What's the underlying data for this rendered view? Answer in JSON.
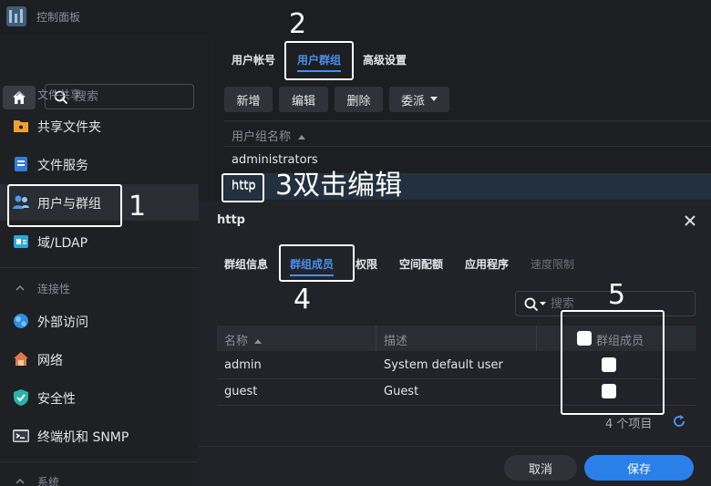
{
  "app": {
    "title": "控制面板"
  },
  "sidebar": {
    "search_placeholder": "搜索",
    "sections": [
      {
        "label": "文件共享",
        "items": [
          {
            "label": "共享文件夹",
            "icon": "folder-icon"
          },
          {
            "label": "文件服务",
            "icon": "file-services-icon"
          },
          {
            "label": "用户与群组",
            "icon": "users-icon",
            "active": true
          },
          {
            "label": "域/LDAP",
            "icon": "domain-icon"
          }
        ]
      },
      {
        "label": "连接性",
        "items": [
          {
            "label": "外部访问",
            "icon": "globe-icon"
          },
          {
            "label": "网络",
            "icon": "network-icon"
          },
          {
            "label": "安全性",
            "icon": "shield-icon"
          },
          {
            "label": "终端机和 SNMP",
            "icon": "terminal-icon"
          }
        ]
      },
      {
        "label": "系统",
        "items": []
      }
    ]
  },
  "main": {
    "tabs": [
      {
        "label": "用户帐号"
      },
      {
        "label": "用户群组",
        "active": true
      },
      {
        "label": "高级设置"
      }
    ],
    "toolbar": {
      "create": "新增",
      "edit": "编辑",
      "delete": "删除",
      "delegate": "委派"
    },
    "group_list": {
      "column_header": "用户组名称",
      "rows": [
        "administrators",
        "http"
      ]
    }
  },
  "annotations": {
    "n1": "1",
    "n2": "2",
    "n3_text": "3双击编辑",
    "n4": "4",
    "n5": "5"
  },
  "dialog": {
    "title": "http",
    "tabs": [
      {
        "label": "群组信息"
      },
      {
        "label": "群组成员",
        "active": true
      },
      {
        "label": "权限"
      },
      {
        "label": "空间配额"
      },
      {
        "label": "应用程序"
      },
      {
        "label": "速度限制",
        "disabled": true
      }
    ],
    "search_placeholder": "搜索",
    "table": {
      "columns": {
        "name": "名称",
        "description": "描述",
        "member": "群组成员"
      },
      "rows": [
        {
          "name": "admin",
          "description": "System default user"
        },
        {
          "name": "guest",
          "description": "Guest"
        }
      ]
    },
    "item_count": "4 个项目",
    "buttons": {
      "cancel": "取消",
      "save": "保存"
    }
  },
  "colors": {
    "accent": "#4a8fe8",
    "primary_button": "#2a7fe8",
    "background": "#1c1e22"
  }
}
